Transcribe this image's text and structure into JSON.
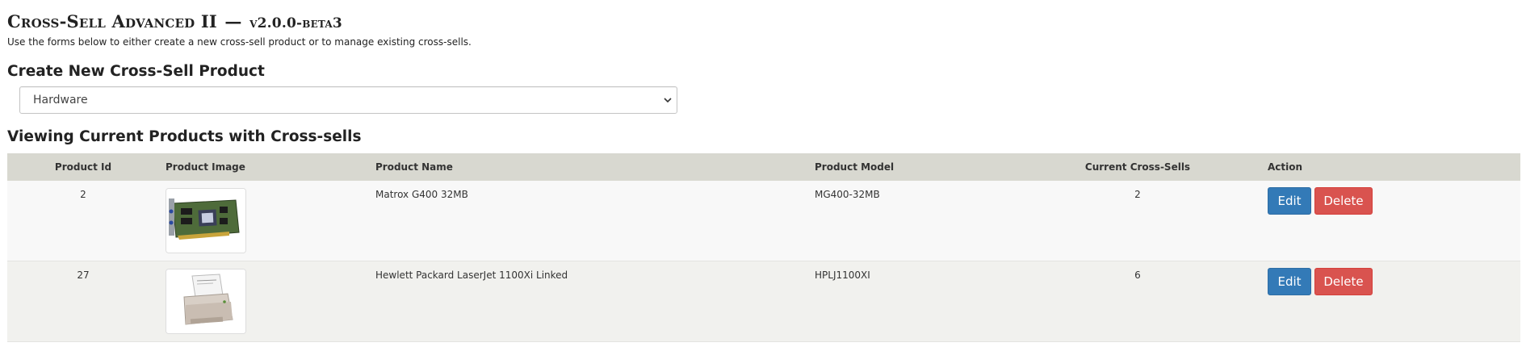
{
  "header": {
    "title": "Cross-Sell Advanced II",
    "separator": "—",
    "version": "v2.0.0-beta3",
    "description": "Use the forms below to either create a new cross-sell product or to manage existing cross-sells."
  },
  "create": {
    "heading": "Create New Cross-Sell Product",
    "category_select": {
      "value": "Hardware"
    }
  },
  "listing": {
    "heading": "Viewing Current Products with Cross-sells",
    "columns": [
      "Product Id",
      "Product Image",
      "Product Name",
      "Product Model",
      "Current Cross-Sells",
      "Action"
    ],
    "rows": [
      {
        "id": "2",
        "image_icon": "graphics-card-image",
        "name": "Matrox G400 32MB",
        "model": "MG400-32MB",
        "cross_sells": "2",
        "edit_label": "Edit",
        "delete_label": "Delete"
      },
      {
        "id": "27",
        "image_icon": "laser-printer-image",
        "name": "Hewlett Packard LaserJet 1100Xi Linked",
        "model": "HPLJ1100XI",
        "cross_sells": "6",
        "edit_label": "Edit",
        "delete_label": "Delete"
      }
    ]
  },
  "colors": {
    "header_row": "#d8d8d0",
    "edit_button": "#337ab7",
    "delete_button": "#d9534f"
  }
}
